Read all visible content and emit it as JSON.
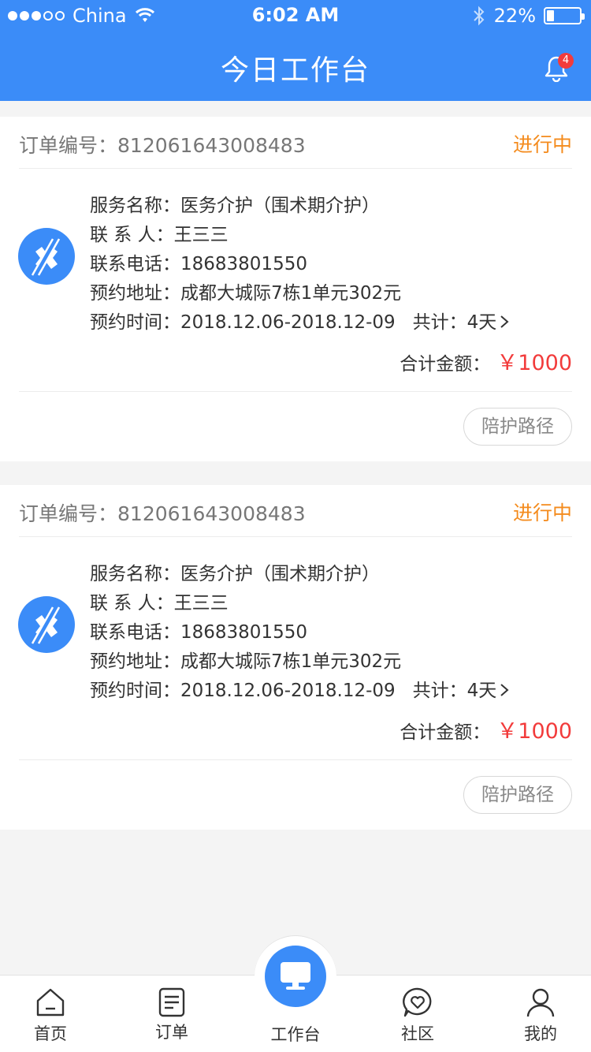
{
  "status_bar": {
    "carrier": "China",
    "time": "6:02 AM",
    "battery_text": "22%",
    "battery_level": 0.22
  },
  "header": {
    "title": "今日工作台",
    "notification_count": "4"
  },
  "orders": [
    {
      "order_label": "订单编号：",
      "order_no": "812061643008483",
      "status": "进行中",
      "service_label": "服务名称：",
      "service": "医务介护（围术期介护）",
      "contact_label": "联 系 人：",
      "contact": "王三三",
      "phone_label": "联系电话：",
      "phone": "18683801550",
      "address_label": "预约地址：",
      "address": "成都大城际7栋1单元302元",
      "time_label": "预约时间：",
      "time": "2018.12.06-2018.12-09",
      "total_days": "共计：4天",
      "amount_label": "合计金额：",
      "amount": "￥1000",
      "route_button": "陪护路径"
    },
    {
      "order_label": "订单编号：",
      "order_no": "812061643008483",
      "status": "进行中",
      "service_label": "服务名称：",
      "service": "医务介护（围术期介护）",
      "contact_label": "联 系 人：",
      "contact": "王三三",
      "phone_label": "联系电话：",
      "phone": "18683801550",
      "address_label": "预约地址：",
      "address": "成都大城际7栋1单元302元",
      "time_label": "预约时间：",
      "time": "2018.12.06-2018.12-09",
      "total_days": "共计：4天",
      "amount_label": "合计金额：",
      "amount": "￥1000",
      "route_button": "陪护路径"
    }
  ],
  "tabbar": {
    "home": "首页",
    "orders": "订单",
    "workbench": "工作台",
    "community": "社区",
    "mine": "我的"
  },
  "colors": {
    "primary": "#3b8cf8",
    "status": "#f48b1d",
    "amount": "#f23b3b",
    "badge": "#f23b3b"
  }
}
